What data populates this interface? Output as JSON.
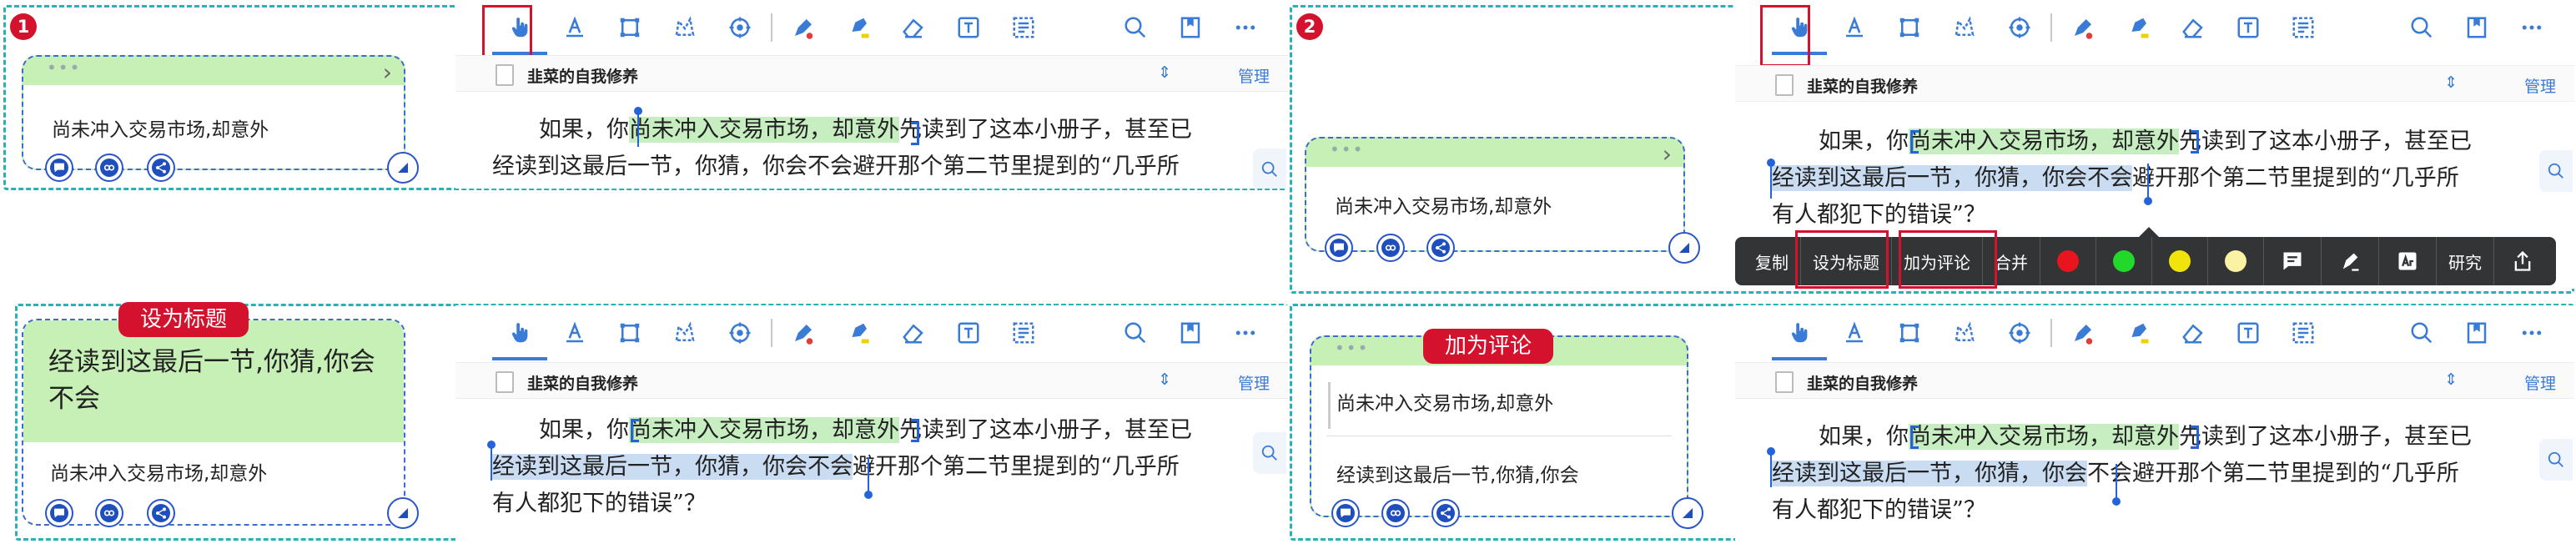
{
  "badges": [
    "1",
    "2"
  ],
  "reader": {
    "doc_title": "韭菜的自我修养",
    "sort_icon": "⇕",
    "manage": "管理",
    "line1_indent": "如果，你",
    "line1_hl": "尚未冲入交易市场，却意外",
    "line1_rest": "先读到了这本小册子，甚至已",
    "line2_all": "经读到这最后一节，你猜，你会不会避开那个第二节里提到的“几乎所",
    "line2_hl_a": "经读到这最后一节，你猜，你会不会",
    "line2_rest_a": "避开那个第二节里提到的“几乎所",
    "line2_hl_b": "经读到这最后一节，你猜，你会",
    "line2_rest_b": "不会避开那个第二节里提到的“几乎所",
    "line3": "有人都犯下的错误”？"
  },
  "toolbar_icons": [
    "hand-pointer-icon",
    "text-underline-icon",
    "rectangle-select-icon",
    "lasso-icon",
    "stamp-icon",
    "pen-icon",
    "highlighter-icon",
    "eraser-icon",
    "text-box-icon",
    "ocr-icon",
    "search-icon",
    "bookmark-icon",
    "more-icon"
  ],
  "cards": {
    "excerpt1": "尚未冲入交易市场,却意外",
    "excerpt2": "经读到这最后一节,你猜,你会",
    "title_text": "经读到这最后一节,你猜,你会不会",
    "dots": "•••",
    "chev": "›"
  },
  "tags": {
    "set_title": "设为标题",
    "add_comment": "加为评论"
  },
  "popup": {
    "copy": "复制",
    "set_title": "设为标题",
    "add_comment": "加为评论",
    "merge": "合并",
    "colors": [
      "#e8141e",
      "#22d82a",
      "#f1e40c",
      "#fbf2a4"
    ],
    "research": "研究"
  },
  "colors": {
    "accent": "#3a7bd5",
    "panel_border": "#2ab0b8",
    "badge_red": "#d4122e",
    "highlight_green": "#c7eec0",
    "highlight_blue": "#c9dcf2"
  }
}
